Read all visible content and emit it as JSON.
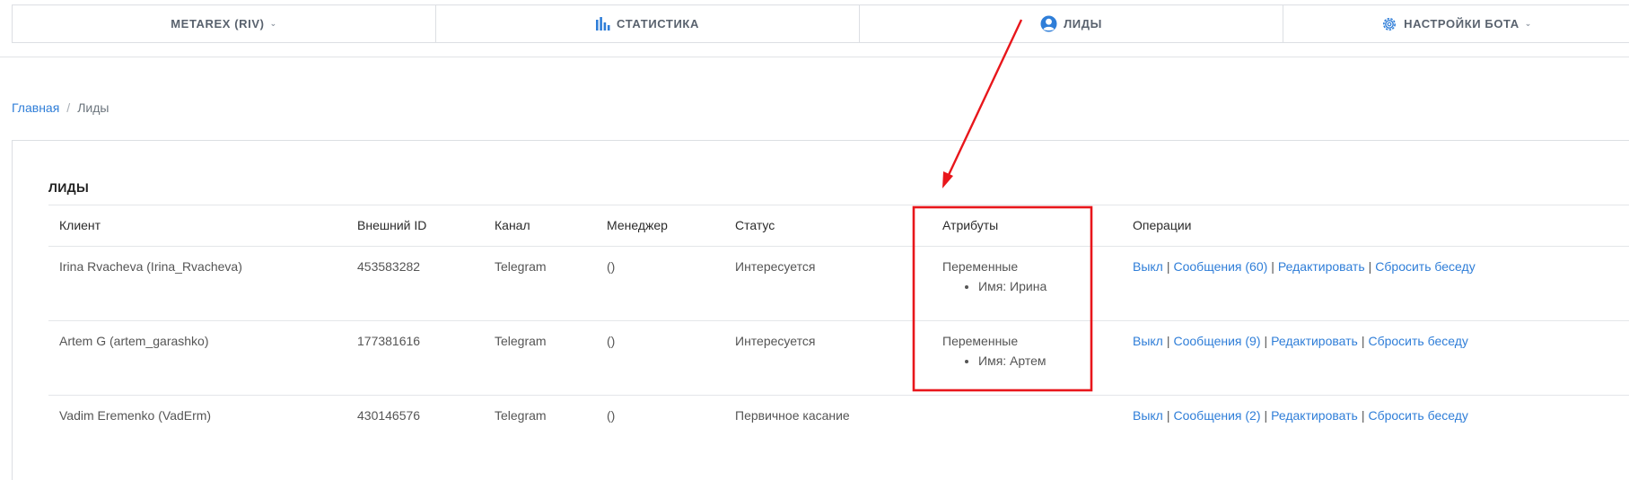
{
  "nav": {
    "items": [
      {
        "label": "METAREX (RIV)",
        "icon": "",
        "dropdown": true
      },
      {
        "label": "СТАТИСТИКА",
        "icon": "bar-chart-icon",
        "dropdown": false
      },
      {
        "label": "ЛИДЫ",
        "icon": "user-icon",
        "dropdown": false
      },
      {
        "label": "НАСТРОЙКИ БОТА",
        "icon": "gear-icon",
        "dropdown": true
      }
    ]
  },
  "breadcrumb": {
    "home": "Главная",
    "current": "Лиды"
  },
  "leads": {
    "title": "ЛИДЫ",
    "columns": [
      "Клиент",
      "Внешний ID",
      "Канал",
      "Менеджер",
      "Статус",
      "Атрибуты",
      "Операции"
    ],
    "rows": [
      {
        "client": "Irina Rvacheva (Irina_Rvacheva)",
        "external_id": "453583282",
        "channel": "Telegram",
        "manager": "()",
        "status": "Интересуется",
        "attr_title": "Переменные",
        "attr_item": "Имя: Ирина",
        "ops": {
          "off": "Выкл",
          "messages": "Сообщения (60)",
          "edit": "Редактировать",
          "reset": "Сбросить беседу"
        }
      },
      {
        "client": "Artem G (artem_garashko)",
        "external_id": "177381616",
        "channel": "Telegram",
        "manager": "()",
        "status": "Интересуется",
        "attr_title": "Переменные",
        "attr_item": "Имя: Артем",
        "ops": {
          "off": "Выкл",
          "messages": "Сообщения (9)",
          "edit": "Редактировать",
          "reset": "Сбросить беседу"
        }
      },
      {
        "client": "Vadim Eremenko (VadErm)",
        "external_id": "430146576",
        "channel": "Telegram",
        "manager": "()",
        "status": "Первичное касание",
        "attr_title": "",
        "attr_item": "",
        "ops": {
          "off": "Выкл",
          "messages": "Сообщения (2)",
          "edit": "Редактировать",
          "reset": "Сбросить беседу"
        }
      }
    ],
    "separator": "|"
  },
  "colors": {
    "link": "#2f7ed8",
    "annotation": "#e8161b"
  }
}
